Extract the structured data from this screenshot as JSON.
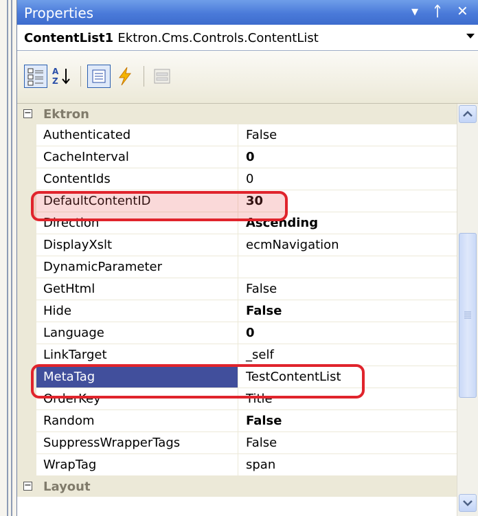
{
  "titlebar": {
    "title": "Properties",
    "dropdown_glyph": "▾",
    "pin_glyph": "ᛏ",
    "close_glyph": "✕"
  },
  "object_selector": {
    "name": "ContentList1",
    "type": "Ektron.Cms.Controls.ContentList"
  },
  "toolbar": {
    "buttons": [
      "categorized-icon",
      "alphabetical-icon",
      "properties-icon",
      "events-icon",
      "property-pages-icon"
    ]
  },
  "category": {
    "label": "Ektron",
    "toggle": "−"
  },
  "properties": [
    {
      "name": "Authenticated",
      "value": "False",
      "bold": false
    },
    {
      "name": "CacheInterval",
      "value": "0",
      "bold": true
    },
    {
      "name": "ContentIds",
      "value": "0",
      "bold": false
    },
    {
      "name": "DefaultContentID",
      "value": "30",
      "bold": true
    },
    {
      "name": "Direction",
      "value": "Ascending",
      "bold": true
    },
    {
      "name": "DisplayXslt",
      "value": "ecmNavigation",
      "bold": false
    },
    {
      "name": "DynamicParameter",
      "value": "",
      "bold": false
    },
    {
      "name": "GetHtml",
      "value": "False",
      "bold": false
    },
    {
      "name": "Hide",
      "value": "False",
      "bold": true
    },
    {
      "name": "Language",
      "value": "0",
      "bold": true
    },
    {
      "name": "LinkTarget",
      "value": "_self",
      "bold": false
    },
    {
      "name": "MetaTag",
      "value": "TestContentList",
      "bold": false,
      "selected": true
    },
    {
      "name": "OrderKey",
      "value": "Title",
      "bold": false
    },
    {
      "name": "Random",
      "value": "False",
      "bold": true
    },
    {
      "name": "SuppressWrapperTags",
      "value": "False",
      "bold": false
    },
    {
      "name": "WrapTag",
      "value": "span",
      "bold": false
    }
  ],
  "next_category": {
    "label": "Layout"
  },
  "colors": {
    "titlebar": "#4a7ad9",
    "highlight": "#e0242c",
    "selection": "#414f9c"
  }
}
